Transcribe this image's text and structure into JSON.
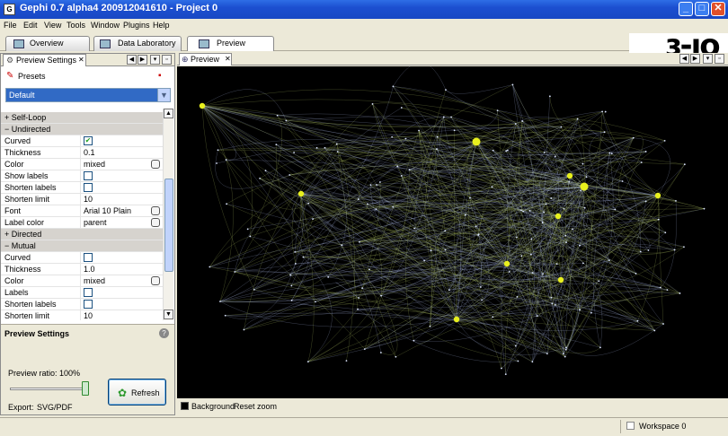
{
  "window": {
    "title": "Gephi 0.7 alpha4 200912041610 - Project 0",
    "icon_glyph": "G",
    "controls": {
      "minimize": "_",
      "maximize": "□",
      "close": "✕"
    }
  },
  "menu": [
    "File",
    "Edit",
    "View",
    "Tools",
    "Window",
    "Plugins",
    "Help"
  ],
  "workspace_tabs": [
    {
      "label": "Overview"
    },
    {
      "label": "Data Laboratory"
    },
    {
      "label": "Preview"
    }
  ],
  "logo_text": "ɜ-ıo",
  "left_panel": {
    "tab_label": "Preview Settings",
    "presets_label": "Presets",
    "preset_selected": "Default",
    "properties": [
      {
        "type": "category",
        "label": "Self-Loop",
        "sign": "+"
      },
      {
        "type": "category",
        "label": "Undirected",
        "sign": "−"
      },
      {
        "type": "check",
        "label": "Curved",
        "checked": true
      },
      {
        "type": "text",
        "label": "Thickness",
        "value": "0.1"
      },
      {
        "type": "text_ellipsis",
        "label": "Color",
        "value": "mixed"
      },
      {
        "type": "check",
        "label": "Show labels",
        "checked": false
      },
      {
        "type": "check",
        "label": "Shorten labels",
        "checked": false
      },
      {
        "type": "text",
        "label": "Shorten limit",
        "value": "10"
      },
      {
        "type": "text_ellipsis",
        "label": "Font",
        "value": "Arial 10 Plain"
      },
      {
        "type": "text_ellipsis",
        "label": "Label color",
        "value": "parent"
      },
      {
        "type": "category",
        "label": "Directed",
        "sign": "+"
      },
      {
        "type": "category",
        "label": "Mutual",
        "sign": "−"
      },
      {
        "type": "check",
        "label": "Curved",
        "checked": false
      },
      {
        "type": "text",
        "label": "Thickness",
        "value": "1.0"
      },
      {
        "type": "text_ellipsis",
        "label": "Color",
        "value": "mixed"
      },
      {
        "type": "check",
        "label": "Labels",
        "checked": false
      },
      {
        "type": "check",
        "label": "Shorten labels",
        "checked": false
      },
      {
        "type": "text",
        "label": "Shorten limit",
        "value": "10"
      }
    ],
    "settings_section": {
      "title": "Preview Settings",
      "ratio_label": "Preview ratio:  100%",
      "ratio_value": 1.0,
      "export_label": "Export:",
      "export_value": "SVG/PDF",
      "refresh_label": "Refresh"
    }
  },
  "preview_panel": {
    "tab_label": "Preview",
    "background_label": "Background",
    "reset_zoom_label": "Reset zoom",
    "colors": {
      "background": "#000000",
      "node": "#e8f01e",
      "edge_a": "#b4c864",
      "edge_b": "#aab8e6"
    }
  },
  "status_bar": {
    "workspace_label": "Workspace 0"
  },
  "colors": {
    "titlebar": "#1c4fd0",
    "chrome": "#ece9d8",
    "selection": "#316ac5"
  }
}
